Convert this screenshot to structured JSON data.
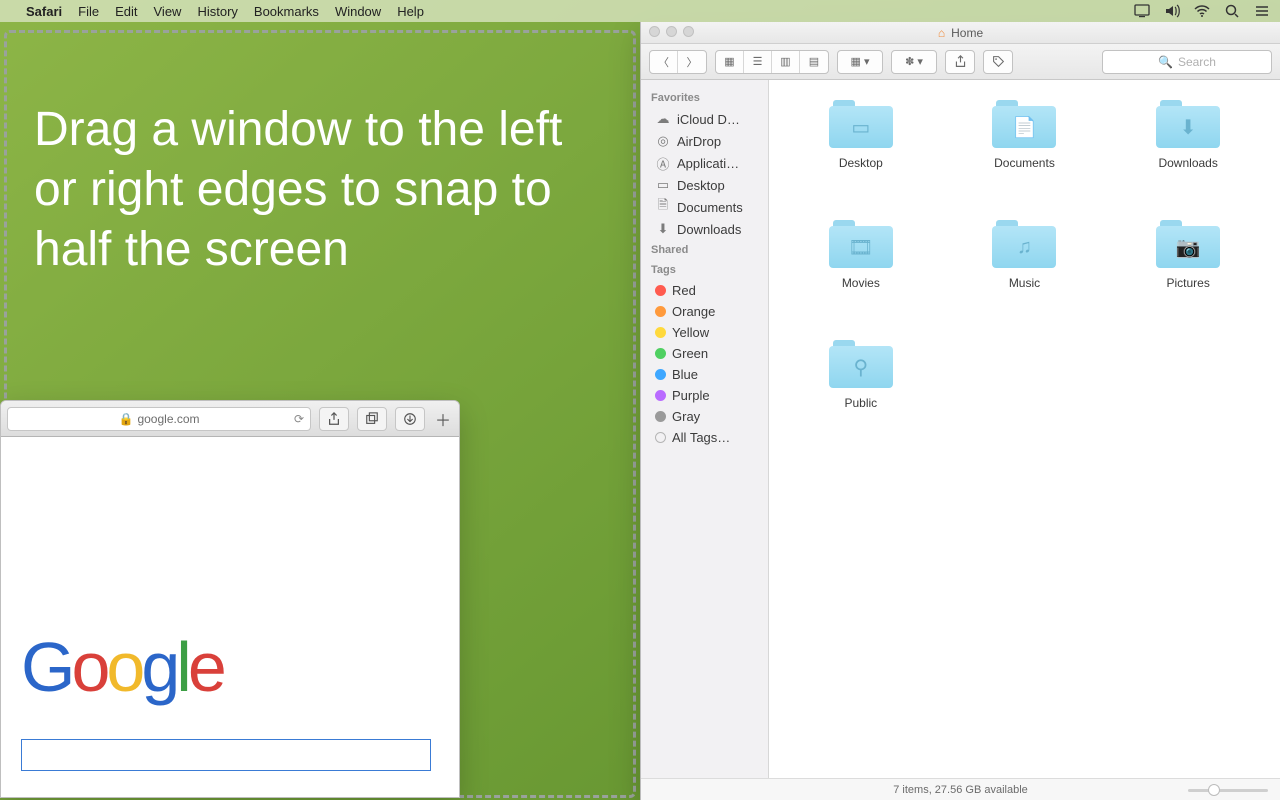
{
  "menubar": {
    "app": "Safari",
    "items": [
      "File",
      "Edit",
      "View",
      "History",
      "Bookmarks",
      "Window",
      "Help"
    ]
  },
  "overlay": {
    "message": "Drag a window to the left or right edges to snap to half the screen"
  },
  "safari": {
    "address": "google.com",
    "search_value": ""
  },
  "finder": {
    "title": "Home",
    "search_placeholder": "Search",
    "sidebar": {
      "favorites_label": "Favorites",
      "favorites": [
        {
          "icon": "cloud",
          "label": "iCloud D…"
        },
        {
          "icon": "airdrop",
          "label": "AirDrop"
        },
        {
          "icon": "apps",
          "label": "Applicati…"
        },
        {
          "icon": "desktop",
          "label": "Desktop"
        },
        {
          "icon": "documents",
          "label": "Documents"
        },
        {
          "icon": "downloads",
          "label": "Downloads"
        }
      ],
      "shared_label": "Shared",
      "tags_label": "Tags",
      "tags": [
        {
          "color": "#ff5b4f",
          "label": "Red"
        },
        {
          "color": "#ff9a3c",
          "label": "Orange"
        },
        {
          "color": "#ffd93c",
          "label": "Yellow"
        },
        {
          "color": "#4fd061",
          "label": "Green"
        },
        {
          "color": "#3ea7ff",
          "label": "Blue"
        },
        {
          "color": "#b96bff",
          "label": "Purple"
        },
        {
          "color": "#9a9a9a",
          "label": "Gray"
        },
        {
          "color": "transparent",
          "label": "All Tags…",
          "outline": true
        }
      ]
    },
    "folders": [
      {
        "name": "Desktop",
        "glyph": "▭"
      },
      {
        "name": "Documents",
        "glyph": "📄"
      },
      {
        "name": "Downloads",
        "glyph": "⬇"
      },
      {
        "name": "Movies",
        "glyph": "🎞"
      },
      {
        "name": "Music",
        "glyph": "♫"
      },
      {
        "name": "Pictures",
        "glyph": "📷"
      },
      {
        "name": "Public",
        "glyph": "⚲"
      }
    ],
    "status": "7 items, 27.56 GB available"
  }
}
